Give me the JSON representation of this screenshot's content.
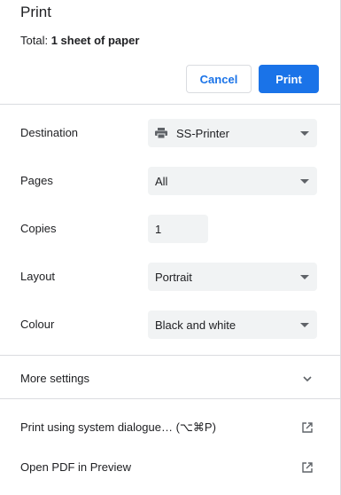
{
  "header": {
    "title": "Print",
    "total_prefix": "Total: ",
    "total_value": "1 sheet of paper"
  },
  "buttons": {
    "cancel_label": "Cancel",
    "print_label": "Print"
  },
  "settings": {
    "destination": {
      "label": "Destination",
      "value": "SS-Printer"
    },
    "pages": {
      "label": "Pages",
      "value": "All"
    },
    "copies": {
      "label": "Copies",
      "value": "1"
    },
    "layout": {
      "label": "Layout",
      "value": "Portrait"
    },
    "colour": {
      "label": "Colour",
      "value": "Black and white"
    }
  },
  "more_settings": {
    "label": "More settings"
  },
  "links": {
    "system_dialog": "Print using system dialogue… (⌥⌘P)",
    "open_pdf": "Open PDF in Preview"
  },
  "colors": {
    "accent": "#1a73e8",
    "field_bg": "#f1f3f4",
    "divider": "#dadce0"
  },
  "icons": {
    "destination": "printer-icon",
    "dropdown": "caret-down-icon",
    "more_settings": "chevron-down-icon",
    "external": "open-in-new-icon"
  }
}
